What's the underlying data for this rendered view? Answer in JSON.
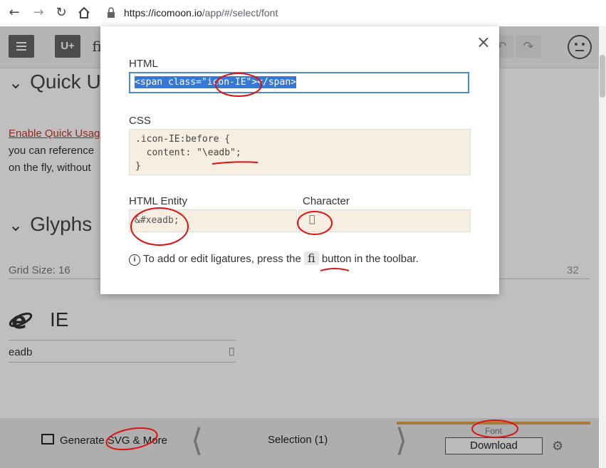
{
  "browser": {
    "back_icon": "arrow-left-icon",
    "forward_icon": "arrow-right-icon",
    "reload_icon": "reload-icon",
    "home_icon": "home-icon",
    "url_host": "https://icomoon.io",
    "url_path": "/app/#/select/font"
  },
  "toolbar": {
    "menu_icon": "hamburger-icon",
    "uplus_label": "U+",
    "ligature_label": "fi",
    "undo_icon": "undo-icon",
    "redo_icon": "redo-icon",
    "face_icon": "smiley-icon"
  },
  "page": {
    "quick_usage_title": "Quick Usage",
    "enable_quick_usage": "Enable Quick Usage",
    "para_line1": "you can reference",
    "para_line2": "on the fly, without",
    "glyphs_title": "Glyphs",
    "grid_size_label": "Grid Size: 16",
    "grid_size_max": "32",
    "glyph_name": "IE",
    "glyph_code": "eadb",
    "glyph_char": ""
  },
  "bottom_bar": {
    "generate_label": "Generate SVG & More",
    "selection_label": "Selection (1)",
    "font_label": "Font",
    "download_label": "Download"
  },
  "modal": {
    "close_label": "×",
    "html_label": "HTML",
    "html_value": "<span class=\"icon-IE\"></span>",
    "css_label": "CSS",
    "css_value": ".icon-IE:before {\n  content: \"\\eadb\";\n}",
    "entity_label": "HTML Entity",
    "entity_value": "&#xeadb;",
    "character_label": "Character",
    "character_value": "",
    "hint_prefix": "To add or edit ligatures, press the",
    "hint_button": "fi",
    "hint_suffix": "button in the toolbar."
  }
}
